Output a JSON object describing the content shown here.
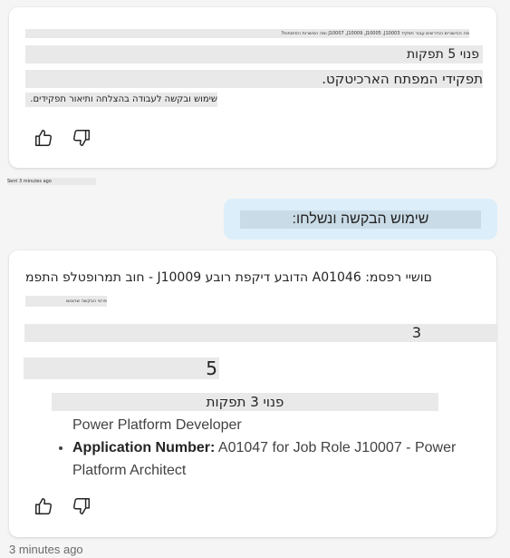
{
  "message1": {
    "line_top": "מה הכישורים הנדרשים עבור תפקיד J10007 ,J10009 ,J10005 ,J10003 ומה המשרות הפתוחות?",
    "line_vacancies": "פנוי 5 תפקות",
    "line_roles": "תפקידי המפתח הארכיטקט.",
    "line_invite": "שימוש ובקשה לעבודה בהצלחה ותיאור תפקידים.",
    "like_label": "Like",
    "dislike_label": "Dislike"
  },
  "meta_small": "Sent 3 minutes ago",
  "user_message": {
    "text": "שימוש הבקשה ונשלחו:"
  },
  "message2": {
    "line_main": "חוב תמרופטלפ התפמ - J10009 הדובע דיקפת רובע A01046 :םושיי רפסמ .",
    "line_sub": "פרטי הבקשה שהוגשו",
    "row_3": "3",
    "row_5": "5",
    "row_vacancies": "פנוי 3 תפקות",
    "bullet1_cont": "Power Platform Developer",
    "bullet2_label": "Application Number:",
    "bullet2_value": " A01047 for Job Role J10007 - Power Platform Architect",
    "like_label": "Like",
    "dislike_label": "Dislike"
  },
  "timestamp": "3 minutes ago"
}
